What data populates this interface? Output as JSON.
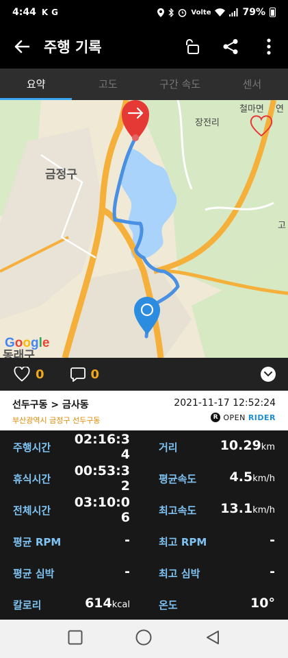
{
  "status_bar": {
    "time": "4:44",
    "left_indicators": [
      "K",
      "G"
    ],
    "right_icons": [
      "location-icon",
      "bluetooth-icon",
      "alarm-icon",
      "volte-icon",
      "wifi-icon",
      "signal-icon",
      "battery-icon"
    ],
    "volte_label": "Volte",
    "battery": "79%"
  },
  "app_bar": {
    "title": "주행 기록"
  },
  "tabs": [
    {
      "label": "요약",
      "active": true
    },
    {
      "label": "고도",
      "active": false
    },
    {
      "label": "구간 속도",
      "active": false
    },
    {
      "label": "센서",
      "active": false
    }
  ],
  "map": {
    "labels": {
      "district": "금정구",
      "cheolmamyeon": "철마면",
      "yeon": "연",
      "jangjeonri": "장전리",
      "go": "고",
      "dongrae": "동래구"
    },
    "attribution": "Google",
    "colors": {
      "route": "#4a90e2",
      "road_major": "#f7b135",
      "water": "#a8d3fb",
      "green": "#cfe7bd",
      "end_marker": "#e53935",
      "start_marker": "#2c8de0"
    }
  },
  "social": {
    "likes": "0",
    "comments": "0"
  },
  "route": {
    "title": "선두구동 > 금사동",
    "subtitle": "부산광역시 금정구 선두구동",
    "date": "2021-11-17 12:52:24",
    "brand_open": "OPEN",
    "brand_rider": "RIDER",
    "brand_logo": "R"
  },
  "stats": {
    "ride_time": {
      "label": "주행시간",
      "value_line1": "02:16:3",
      "value_line2": "4"
    },
    "rest_time": {
      "label": "휴식시간",
      "value_line1": "00:53:3",
      "value_line2": "2"
    },
    "total_time": {
      "label": "전체시간",
      "value_line1": "03:10:0",
      "value_line2": "6"
    },
    "distance": {
      "label": "거리",
      "value": "10.29",
      "unit": "km"
    },
    "avg_speed": {
      "label": "평균속도",
      "value": "4.5",
      "unit": "km/h"
    },
    "max_speed": {
      "label": "최고속도",
      "value": "13.1",
      "unit": "km/h"
    },
    "avg_rpm": {
      "label": "평균 RPM",
      "value": "-"
    },
    "max_rpm": {
      "label": "최고 RPM",
      "value": "-"
    },
    "avg_hr": {
      "label": "평균 심박",
      "value": "-"
    },
    "max_hr": {
      "label": "최고 심박",
      "value": "-"
    },
    "calories": {
      "label": "칼로리",
      "value": "614",
      "unit": "kcal"
    },
    "temperature": {
      "label": "온도",
      "value": "10°"
    }
  }
}
